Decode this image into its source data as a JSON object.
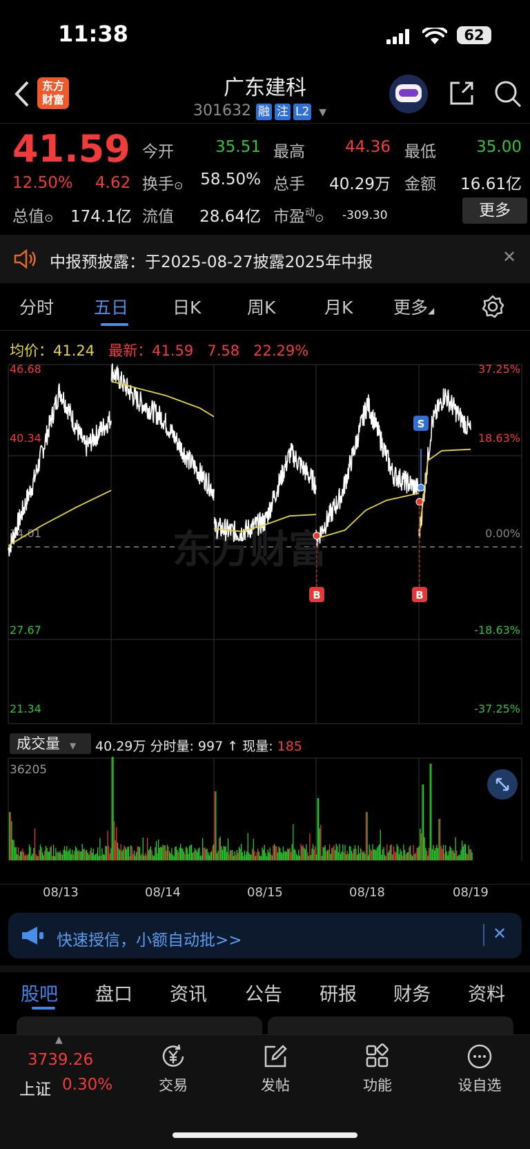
{
  "status": {
    "time": "11:38",
    "battery": "62"
  },
  "header": {
    "logo_line1": "东方",
    "logo_line2": "财富",
    "title": "广东建科",
    "code": "301632",
    "tags": [
      "融",
      "注",
      "L2"
    ]
  },
  "quote": {
    "price": "41.59",
    "change_pct": "12.50%",
    "change_amt": "4.62",
    "open_label": "今开",
    "open": "35.51",
    "high_label": "最高",
    "high": "44.36",
    "low_label": "最低",
    "low": "35.00",
    "turnover_label": "换手",
    "turnover": "58.50%",
    "volume_label": "总手",
    "volume": "40.29万",
    "amount_label": "金额",
    "amount": "16.61亿",
    "mktcap_label": "总值",
    "mktcap": "174.1亿",
    "float_label": "流值",
    "float": "28.64亿",
    "pe_label": "市盈",
    "pe_sup": "动",
    "pe": "-309.30",
    "more": "更多"
  },
  "notice": {
    "text": "中报预披露：于2025-08-27披露2025年中报"
  },
  "tabs": [
    "分时",
    "五日",
    "日K",
    "周K",
    "月K",
    "更多"
  ],
  "active_tab": "五日",
  "info_line": {
    "avg_label": "均价：",
    "avg": "41.24",
    "latest_label": "最新：",
    "latest": "41.59",
    "chg": "7.58",
    "pct": "22.29%"
  },
  "chart_data": {
    "type": "line",
    "left_axis": [
      "46.68",
      "40.34",
      "34.01",
      "27.67",
      "21.34"
    ],
    "right_axis": [
      "37.25%",
      "18.63%",
      "0.00%",
      "-18.63%",
      "-37.25%"
    ],
    "dates": [
      "08/13",
      "08/14",
      "08/15",
      "08/18",
      "08/19"
    ],
    "base_price": 34.01,
    "ylim": [
      21.34,
      46.68
    ],
    "markers": [
      {
        "label": "B"
      },
      {
        "label": "B"
      },
      {
        "label": "S"
      }
    ],
    "watermark": "东方财富",
    "colors": {
      "price": "#ffffff",
      "avg": "#e8d53a"
    }
  },
  "volume": {
    "label": "成交量",
    "total": "40.29万",
    "minute_label": "分时量:",
    "minute": "997",
    "arrow": "↑",
    "now_label": "现量:",
    "now": "185",
    "max": "36205"
  },
  "banner": {
    "text": "快速授信，小额自动批>>"
  },
  "bottom_tabs": [
    "股吧",
    "盘口",
    "资讯",
    "公告",
    "研报",
    "财务",
    "资料"
  ],
  "nav": {
    "index_value": "3739.26",
    "index_name": "上证",
    "index_pct": "0.30%",
    "items": [
      "交易",
      "发帖",
      "功能",
      "设自选"
    ]
  }
}
